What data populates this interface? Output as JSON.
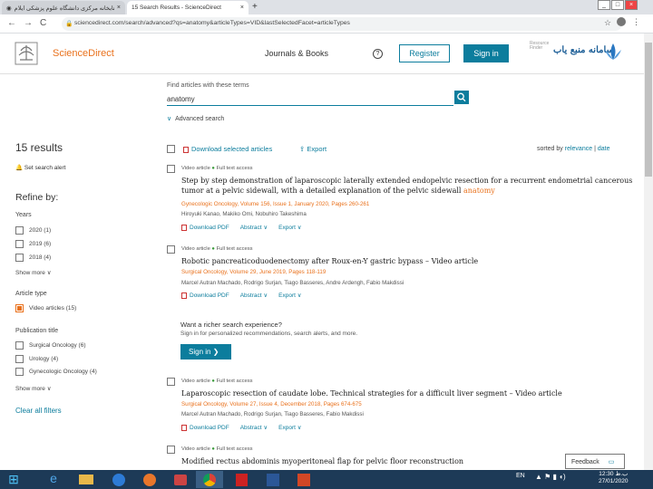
{
  "browser": {
    "tabs": [
      {
        "title": "کتابخانه مرکزی دانشگاه علوم پزشکی ایلام",
        "close": "×"
      },
      {
        "title": "15 Search Results - ScienceDirect",
        "close": "×"
      }
    ],
    "new_tab": "+",
    "window_buttons": [
      "_",
      "□",
      "×"
    ],
    "nav": {
      "back": "←",
      "forward": "→",
      "reload": "C"
    },
    "url": "sciencedirect.com/search/advanced?qs=anatomy&articleTypes=VID&lastSelectedFacet=articleTypes"
  },
  "header": {
    "brand": "ScienceDirect",
    "journals_books": "Journals & Books",
    "help": "?",
    "register": "Register",
    "sign_in": "Sign in",
    "resource_finder": "Resource Finder",
    "library_logo": "سامانه منبع یاب"
  },
  "search": {
    "find_label": "Find articles with these terms",
    "query": "anatomy",
    "advanced": "Advanced search"
  },
  "sidebar": {
    "results_count": "15 results",
    "set_alert": "Set search alert",
    "refine": "Refine by:",
    "years_heading": "Years",
    "years": [
      {
        "label": "2020 (1)"
      },
      {
        "label": "2019 (6)"
      },
      {
        "label": "2018 (4)"
      }
    ],
    "show_more": "Show more",
    "article_type_heading": "Article type",
    "article_types": [
      {
        "label": "Video articles (15)"
      }
    ],
    "pub_title_heading": "Publication title",
    "publications": [
      {
        "label": "Surgical Oncology (6)"
      },
      {
        "label": "Urology (4)"
      },
      {
        "label": "Gynecologic Oncology (4)"
      }
    ],
    "show_more_2": "Show more",
    "clear_filters": "Clear all filters"
  },
  "toolbar": {
    "download_selected": "Download selected articles",
    "export": "Export",
    "sorted_by": "sorted by",
    "relevance": "relevance",
    "sep": "|",
    "date": "date"
  },
  "results": [
    {
      "type": "Video article",
      "access": "Full text access",
      "title_pre": "Step by step demonstration of laparoscopic laterally extended endopelvic resection for a recurrent endometrial cancerous tumor at a pelvic sidewall, with a detailed explanation of the pelvic sidewall ",
      "title_hl": "anatomy",
      "source": "Gynecologic Oncology, Volume 156, Issue 1, January 2020, Pages 260-261",
      "authors": "Hiroyuki Kanao, Makiko Omi, Nobuhiro Takeshima",
      "actions": [
        "Download PDF",
        "Abstract",
        "Export"
      ]
    },
    {
      "type": "Video article",
      "access": "Full text access",
      "title_pre": "Robotic pancreaticoduodenectomy after Roux-en-Y gastric bypass – Video article",
      "title_hl": "",
      "source": "Surgical Oncology, Volume 29, June 2019, Pages 118-119",
      "authors": "Marcel Autran Machado, Rodrigo Surjan, Tiago Basseres, Andre Ardengh, Fabio Makdissi",
      "actions": [
        "Download PDF",
        "Abstract",
        "Export"
      ]
    },
    {
      "type": "Video article",
      "access": "Full text access",
      "title_pre": "Laparoscopic resection of caudate lobe. Technical strategies for a difficult liver segment – Video article",
      "title_hl": "",
      "source": "Surgical Oncology, Volume 27, Issue 4, December 2018, Pages 674-675",
      "authors": "Marcel Autran Machado, Rodrigo Surjan, Tiago Basseres, Fabio Makdissi",
      "actions": [
        "Download PDF",
        "Abstract",
        "Export"
      ]
    },
    {
      "type": "Video article",
      "access": "Full text access",
      "title_pre": "Modified rectus abdominis myoperitoneal flap for pelvic floor reconstruction",
      "title_hl": ""
    }
  ],
  "promo": {
    "title": "Want a richer search experience?",
    "text": "Sign in for personalized recommendations, search alerts, and more.",
    "button": "Sign in"
  },
  "feedback": "Feedback",
  "taskbar": {
    "lang": "EN",
    "time": "12:30 ب.ظ",
    "date": "27/01/2020"
  },
  "colors": {
    "accent": "#0c7d9d",
    "brand_orange": "#e9711c",
    "oa_green": "#3a9b3a"
  }
}
